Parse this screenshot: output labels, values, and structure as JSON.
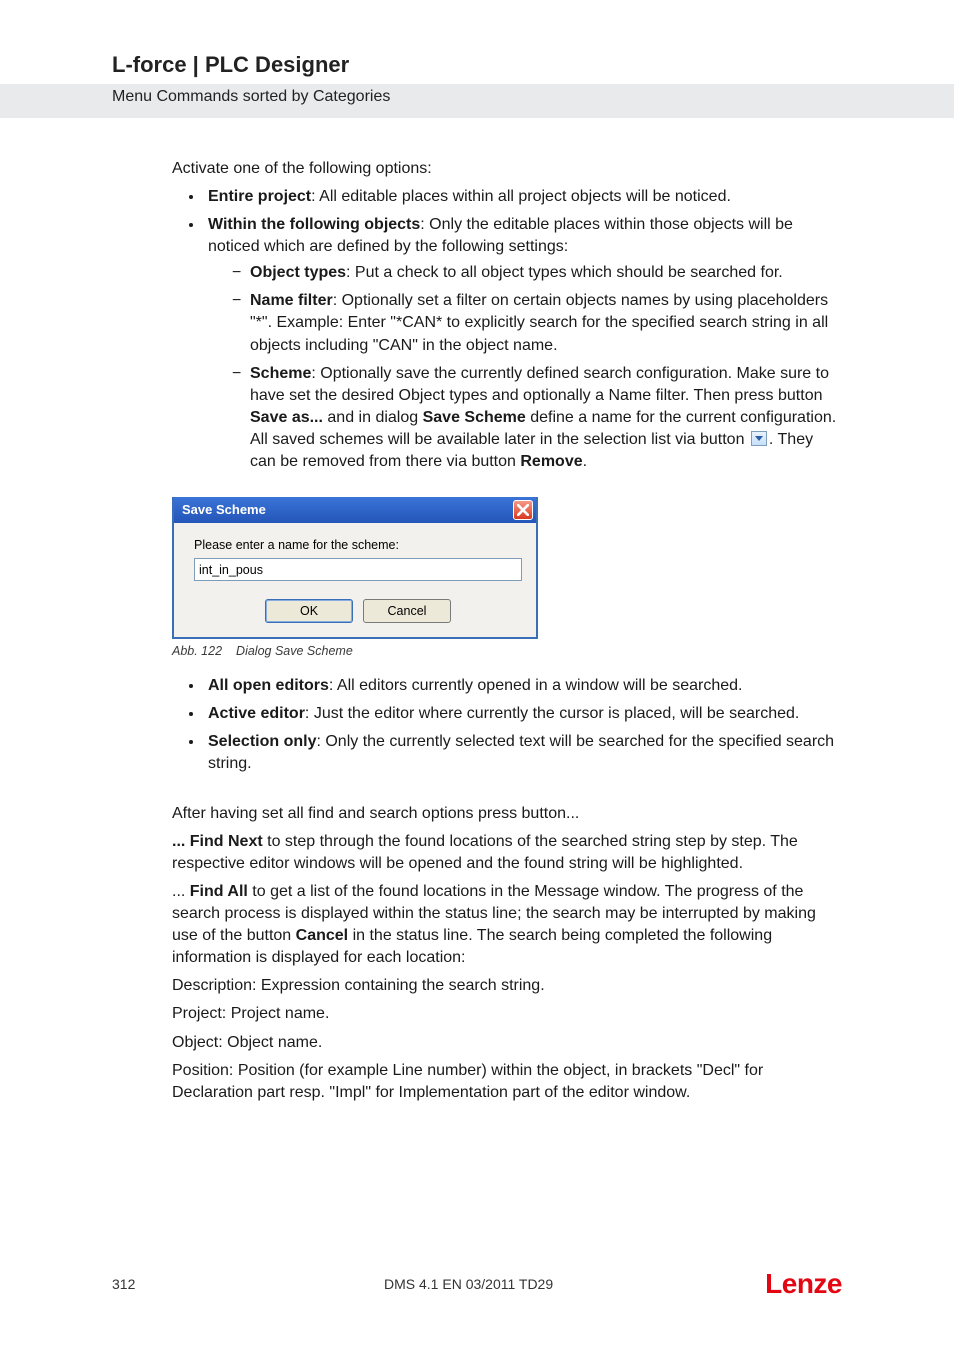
{
  "header": {
    "title": "L-force | PLC Designer",
    "subtitle": "Menu Commands sorted by Categories"
  },
  "body": {
    "intro": "Activate one of the following options:",
    "entire_bold": "Entire project",
    "entire_rest": ": All editable places within all project objects will be noticed.",
    "within_bold": "Within the following objects",
    "within_rest": ": Only the editable places within those objects will be noticed which are defined by the following settings:",
    "obj_types_bold": "Object types",
    "obj_types_rest": ": Put a check to all object types which should be searched for.",
    "name_filter_bold": "Name filter",
    "name_filter_rest": ": Optionally set a filter on certain objects names by using placeholders \"*\". Example: Enter  \"*CAN* to explicitly search for  the specified search string in all objects including \"CAN\" in the object name.",
    "scheme_bold": "Scheme",
    "scheme_1": ": Optionally save the currently defined search configuration. Make sure to have set the desired Object types and optionally a Name filter. Then press button ",
    "scheme_saveas": "Save as...",
    "scheme_2": " and in dialog ",
    "scheme_save_scheme": "Save Scheme",
    "scheme_3": " define a name for the current configuration. All saved schemes will be available later in the selection list via button ",
    "scheme_4": ". They can be removed from there via button ",
    "scheme_remove": "Remove",
    "scheme_5": "."
  },
  "dialog": {
    "title": "Save Scheme",
    "label": "Please enter a name for the scheme:",
    "value": "int_in_pous",
    "ok": "OK",
    "cancel": "Cancel"
  },
  "caption": {
    "abb": "Abb. 122",
    "text": "Dialog Save Scheme"
  },
  "body2": {
    "all_open_bold": "All open editors",
    "all_open_rest": ": All editors currently opened in a window will be searched.",
    "active_ed_bold": "Active editor",
    "active_ed_rest": ": Just the editor where currently the cursor is placed, will be searched.",
    "sel_only_bold": "Selection only",
    "sel_only_rest": ": Only the currently selected text will be searched for the specified search string.",
    "after": "After having set all find and search options press button...",
    "fn_bold": "... Find Next",
    "fn_rest": "  to step through the found locations of the searched string step by step. The respective editor windows will be opened and the found string will be highlighted.",
    "fa_pre": "... ",
    "fa_bold": "Find All",
    "fa_1": " to get a list of the found locations in the Message window. The progress of the search process is displayed within the status line; the search may be interrupted by making use of the button ",
    "fa_cancel": "Cancel",
    "fa_2": " in the status line. The search being completed the following information is displayed for each location:",
    "desc": "Description:  Expression containing the search string.",
    "proj": "Project:  Project name.",
    "obj": "Object:  Object name.",
    "pos": "Position:  Position (for example Line number) within the object, in brackets \"Decl\" for Declaration part resp. \"Impl\" for Implementation part of the editor window."
  },
  "footer": {
    "page": "312",
    "docid": "DMS 4.1 EN 03/2011 TD29",
    "brand": "Lenze"
  }
}
